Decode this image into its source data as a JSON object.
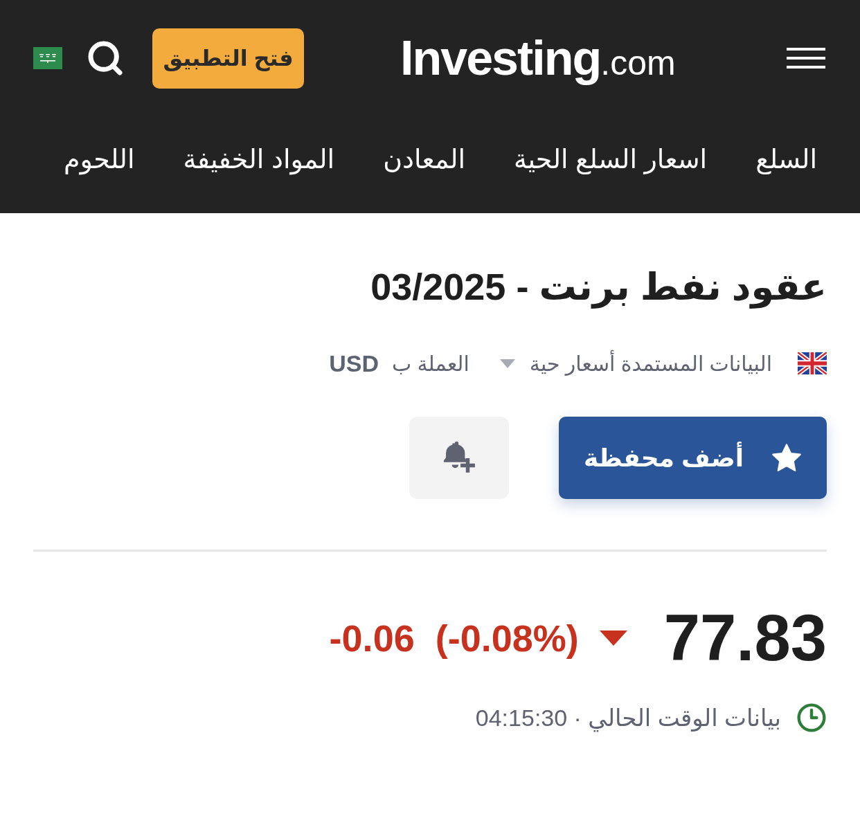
{
  "header": {
    "open_app_button": "فتح التطبيق",
    "logo": "**Investing**.com"
  },
  "nav": {
    "items": [
      "السلع",
      "اسعار السلع الحية",
      "المعادن",
      "المواد الخفيفة",
      "اللحوم"
    ]
  },
  "instrument": {
    "title": "عقود نفط برنت - 03/2025",
    "data_source": "البيانات المستمدة أسعار حية",
    "currency_label": "العملة ب",
    "currency": "USD"
  },
  "actions": {
    "add_portfolio_button": "أضف محفظة"
  },
  "quote": {
    "price": "77.83",
    "falling": true,
    "change": "-0.06",
    "change_percent": "(-0.08%)",
    "status": "بيانات الوقت الحالي · 04:15:30"
  }
}
